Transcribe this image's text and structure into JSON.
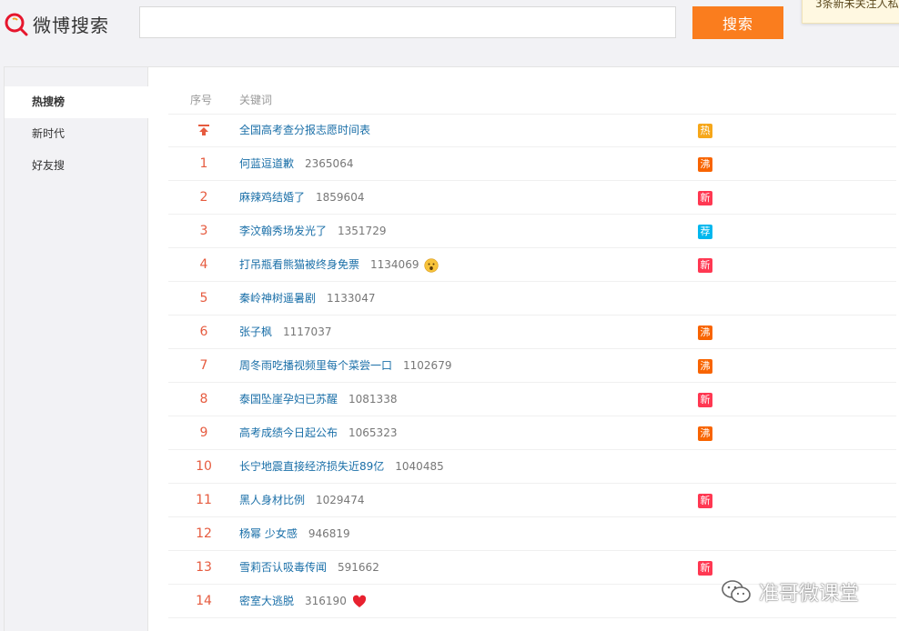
{
  "header": {
    "logo_text": "微博搜索",
    "search_placeholder": "",
    "search_button": "搜索",
    "notice_text": "3条新未关注人私"
  },
  "sidebar": {
    "items": [
      {
        "label": "热搜榜",
        "active": true
      },
      {
        "label": "新时代",
        "active": false
      },
      {
        "label": "好友搜",
        "active": false
      }
    ]
  },
  "table": {
    "col_rank": "序号",
    "col_keyword": "关键词",
    "rows": [
      {
        "rank": "",
        "pinned": true,
        "keyword": "全国高考查分报志愿时间表",
        "count": "",
        "emoji": "",
        "badge": "热",
        "badge_color": "#f6a71a"
      },
      {
        "rank": "1",
        "keyword": "何蓝逗道歉",
        "count": "2365064",
        "emoji": "",
        "badge": "沸",
        "badge_color": "#f86400"
      },
      {
        "rank": "2",
        "keyword": "麻辣鸡结婚了",
        "count": "1859604",
        "emoji": "",
        "badge": "新",
        "badge_color": "#ff3852"
      },
      {
        "rank": "3",
        "keyword": "李汶翰秀场发光了",
        "count": "1351729",
        "emoji": "",
        "badge": "荐",
        "badge_color": "#00b7ee"
      },
      {
        "rank": "4",
        "keyword": "打吊瓶看熊猫被终身免票",
        "count": "1134069",
        "emoji": "shocked-emoji",
        "badge": "新",
        "badge_color": "#ff3852"
      },
      {
        "rank": "5",
        "keyword": "秦岭神树遥暑剧",
        "count": "1133047",
        "emoji": "",
        "badge": "",
        "badge_color": ""
      },
      {
        "rank": "6",
        "keyword": "张子枫",
        "count": "1117037",
        "emoji": "",
        "badge": "沸",
        "badge_color": "#f86400"
      },
      {
        "rank": "7",
        "keyword": "周冬雨吃播视频里每个菜尝一口",
        "count": "1102679",
        "emoji": "",
        "badge": "沸",
        "badge_color": "#f86400"
      },
      {
        "rank": "8",
        "keyword": "泰国坠崖孕妇已苏醒",
        "count": "1081338",
        "emoji": "",
        "badge": "新",
        "badge_color": "#ff3852"
      },
      {
        "rank": "9",
        "keyword": "高考成绩今日起公布",
        "count": "1065323",
        "emoji": "",
        "badge": "沸",
        "badge_color": "#f86400"
      },
      {
        "rank": "10",
        "keyword": "长宁地震直接经济损失近89亿",
        "count": "1040485",
        "emoji": "",
        "badge": "",
        "badge_color": ""
      },
      {
        "rank": "11",
        "keyword": "黑人身材比例",
        "count": "1029474",
        "emoji": "",
        "badge": "新",
        "badge_color": "#ff3852"
      },
      {
        "rank": "12",
        "keyword": "杨幂 少女感",
        "count": "946819",
        "emoji": "",
        "badge": "",
        "badge_color": ""
      },
      {
        "rank": "13",
        "keyword": "雪莉否认吸毒传闻",
        "count": "591662",
        "emoji": "",
        "badge": "新",
        "badge_color": "#ff3852"
      },
      {
        "rank": "14",
        "keyword": "密室大逃脱",
        "count": "316190",
        "emoji": "heart-emoji",
        "badge": "",
        "badge_color": ""
      }
    ]
  },
  "watermark": {
    "text": "准哥微课堂"
  },
  "colors": {
    "accent": "#fa7d1e",
    "rank": "#e65b3f",
    "link": "#1a6fa8"
  }
}
